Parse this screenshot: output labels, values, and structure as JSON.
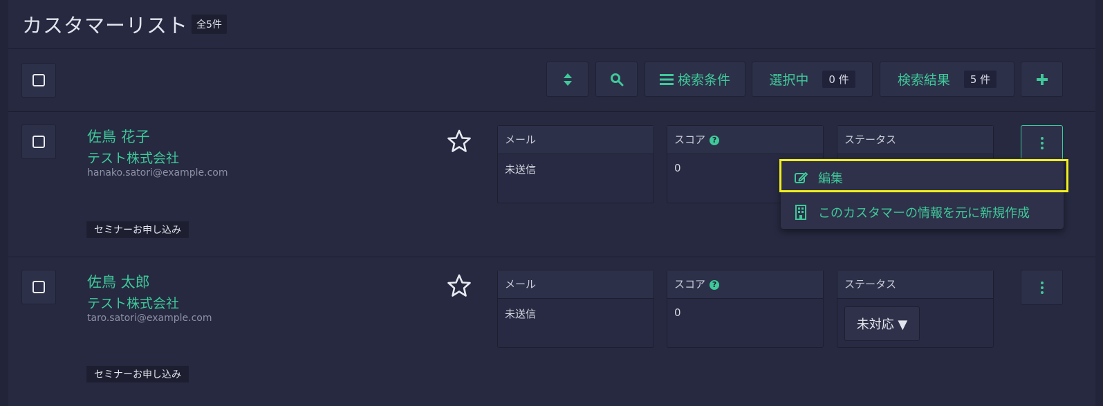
{
  "header": {
    "title": "カスタマーリスト",
    "count_badge": "全5件"
  },
  "toolbar": {
    "search_conditions_label": "検索条件",
    "selected_label": "選択中",
    "selected_count": "0 件",
    "results_label": "検索結果",
    "results_count": "5 件",
    "icons": [
      "sort-icon",
      "search-icon",
      "list-icon",
      "plus-icon"
    ]
  },
  "customers": [
    {
      "name": "佐鳥 花子",
      "company": "テスト株式会社",
      "email": "hanako.satori@example.com",
      "tag": "セミナーお申し込み",
      "mail_label": "メール",
      "mail_value": "未送信",
      "score_label": "スコア",
      "score_value": "0",
      "status_label": "ステータス"
    },
    {
      "name": "佐鳥 太郎",
      "company": "テスト株式会社",
      "email": "taro.satori@example.com",
      "tag": "セミナーお申し込み",
      "mail_label": "メール",
      "mail_value": "未送信",
      "score_label": "スコア",
      "score_value": "0",
      "status_label": "ステータス",
      "status_value": "未対応 ▼"
    }
  ],
  "dropdown_menu": {
    "items": [
      {
        "label": "編集",
        "icon": "edit-icon"
      },
      {
        "label": "このカスタマーの情報を元に新規作成",
        "icon": "building-icon"
      }
    ]
  },
  "colors": {
    "background": "#262940",
    "accent": "#3fc99a",
    "highlight": "#f2f01a"
  }
}
